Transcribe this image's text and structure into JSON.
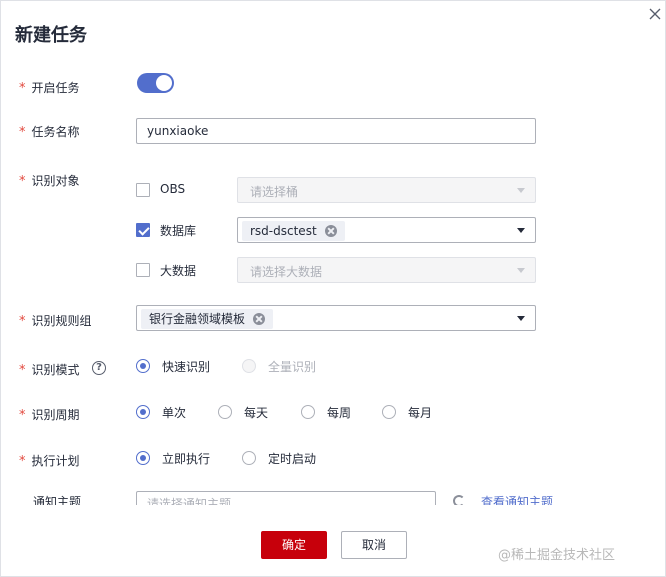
{
  "dialog": {
    "title": "新建任务",
    "close_icon": "close-icon"
  },
  "form": {
    "enable": {
      "label": "开启任务",
      "value": true
    },
    "task_name": {
      "label": "任务名称",
      "value": "yunxiaoke"
    },
    "target": {
      "label": "识别对象",
      "obs": {
        "label": "OBS",
        "checked": false,
        "placeholder": "请选择桶"
      },
      "database": {
        "label": "数据库",
        "checked": true,
        "tag": "rsd-dsctest"
      },
      "bigdata": {
        "label": "大数据",
        "checked": false,
        "placeholder": "请选择大数据"
      }
    },
    "rule_group": {
      "label": "识别规则组",
      "tag": "银行金融领域模板"
    },
    "mode": {
      "label": "识别模式",
      "help_icon": "question-icon",
      "options": [
        "快速识别",
        "全量识别"
      ],
      "selected": "快速识别"
    },
    "period": {
      "label": "识别周期",
      "options": [
        "单次",
        "每天",
        "每周",
        "每月"
      ],
      "selected": "单次"
    },
    "plan": {
      "label": "执行计划",
      "options": [
        "立即执行",
        "定时启动"
      ],
      "selected": "立即执行"
    },
    "notify": {
      "label": "通知主题",
      "placeholder": "请选择通知主题",
      "refresh_icon": "refresh-icon",
      "link": "查看通知主题"
    }
  },
  "footer": {
    "confirm": "确定",
    "cancel": "取消"
  },
  "watermark": "@稀土掘金技术社区",
  "colors": {
    "accent": "#526ecc",
    "primary_button": "#c7000b",
    "required": "#e2483d"
  }
}
